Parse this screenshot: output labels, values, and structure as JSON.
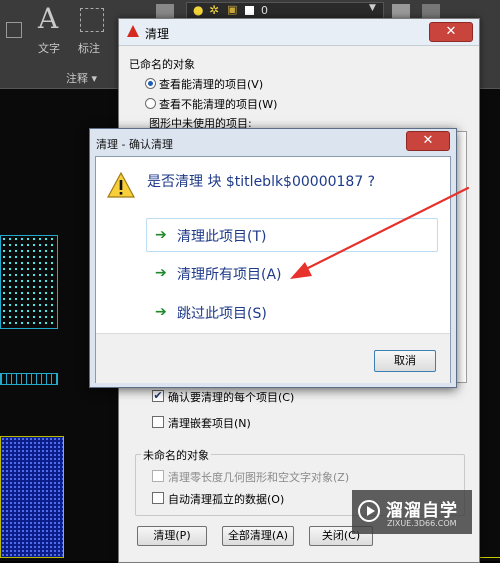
{
  "ribbon": {
    "text_tool_label": "文字",
    "dim_tool_label": "标注",
    "annotation_panel_label": "注释 ▾",
    "layer_value": "0"
  },
  "purge_dialog": {
    "title": "清理",
    "close_glyph": "✕",
    "named_objects_group": "已命名的对象",
    "radio_purgeable": "查看能清理的项目(V)",
    "radio_not_purgeable": "查看不能清理的项目(W)",
    "unused_items_label": "图形中未使用的项目:",
    "confirm_each_label": "确认要清理的每个项目(C)",
    "confirm_each_checked": true,
    "purge_nested_label": "清理嵌套项目(N)",
    "purge_nested_checked": false,
    "unnamed_objects_group": "未命名的对象",
    "zero_length_label": "清理零长度几何图形和空文字对象(Z)",
    "auto_purge_label": "自动清理孤立的数据(O)",
    "buttons": {
      "purge": "清理(P)",
      "purge_all": "全部清理(A)",
      "close": "关闭(C)"
    }
  },
  "confirm_dialog": {
    "title": "清理 - 确认清理",
    "close_glyph": "✕",
    "question": "是否清理 块 $titleblk$00000187 ?",
    "options": [
      {
        "label": "清理此项目(T)"
      },
      {
        "label": "清理所有项目(A)"
      },
      {
        "label": "跳过此项目(S)"
      }
    ],
    "cancel": "取消"
  },
  "watermark": {
    "brand": "溜溜自学",
    "url": "ZIXUE.3D66.COM"
  },
  "colors": {
    "accent_red": "#e8322c",
    "option_text": "#1e3a8a",
    "option_arrow": "#1f8a2a"
  }
}
